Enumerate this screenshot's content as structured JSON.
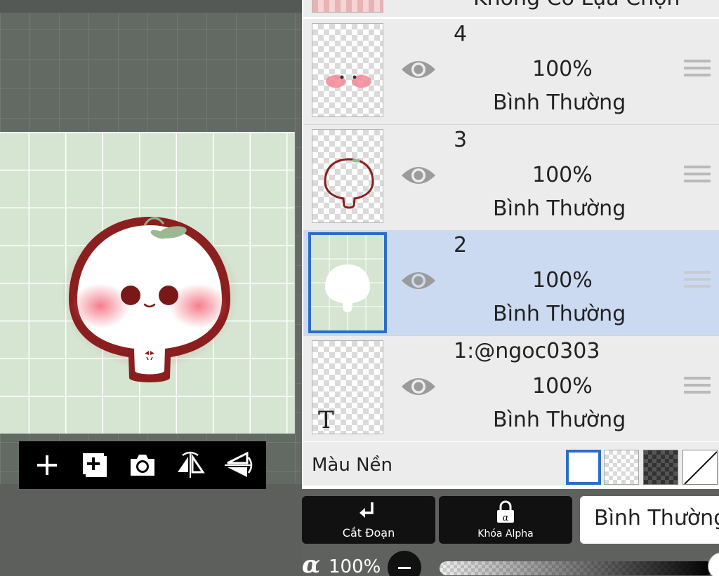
{
  "canvas_toolbar": {
    "buttons": [
      "add-layer-icon",
      "add-layer-box-icon",
      "camera-icon",
      "flip-horizontal-icon",
      "flip-vertical-icon"
    ]
  },
  "layers_panel": {
    "top_cut_text": "Không Có Lựa Chọn",
    "layers": [
      {
        "name": "4",
        "opacity": "100%",
        "blend": "Bình Thường",
        "visible": true,
        "selected": false
      },
      {
        "name": "3",
        "opacity": "100%",
        "blend": "Bình Thường",
        "visible": true,
        "selected": false
      },
      {
        "name": "2",
        "opacity": "100%",
        "blend": "Bình Thường",
        "visible": true,
        "selected": true
      },
      {
        "name": "1:@ngoc0303",
        "opacity": "100%",
        "blend": "Bình Thường",
        "visible": true,
        "selected": false
      }
    ],
    "background": {
      "label": "Màu Nền",
      "options": [
        "white",
        "transparent",
        "dark-checker",
        "none"
      ],
      "selected": "white"
    }
  },
  "bottom_controls": {
    "clipping_label": "Cắt Đoạn",
    "alpha_lock_label": "Khóa Alpha",
    "blend_mode": "Bình Thường",
    "alpha_symbol": "α",
    "opacity": "100%"
  },
  "colors": {
    "selected_row": "#ccdaf1",
    "selection_border": "#2c6ec7",
    "artboard": "#d5e5d2",
    "outline": "#8b1e1e",
    "blush": "#f27c8a"
  }
}
